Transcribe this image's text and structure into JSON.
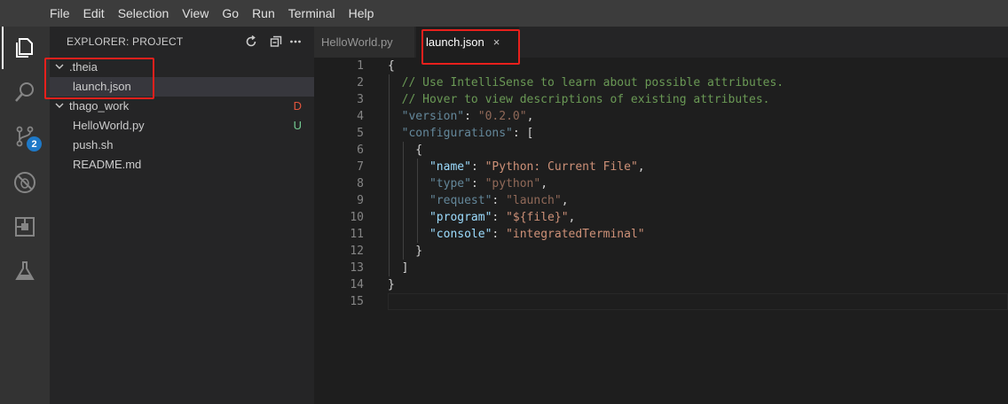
{
  "menu": [
    "File",
    "Edit",
    "Selection",
    "View",
    "Go",
    "Run",
    "Terminal",
    "Help"
  ],
  "activity_bar": {
    "items": [
      "explorer-icon",
      "search-icon",
      "source-control-icon",
      "debug-icon",
      "extensions-icon",
      "test-flask-icon"
    ],
    "source_control_badge": "2"
  },
  "explorer": {
    "title": "EXPLORER: PROJECT",
    "actions": [
      "refresh-icon",
      "collapse-all-icon",
      "more-icon"
    ],
    "tree": [
      {
        "label": ".theia",
        "type": "folder",
        "expanded": true
      },
      {
        "label": "launch.json",
        "type": "file",
        "selected": true
      },
      {
        "label": "thago_work",
        "type": "folder",
        "expanded": true,
        "decoration": "D"
      },
      {
        "label": "HelloWorld.py",
        "type": "file",
        "decoration": "U"
      },
      {
        "label": "push.sh",
        "type": "file"
      },
      {
        "label": "README.md",
        "type": "file"
      }
    ]
  },
  "tabs": [
    {
      "label": "HelloWorld.py",
      "active": false
    },
    {
      "label": "launch.json",
      "active": true,
      "close": "×"
    }
  ],
  "editor": {
    "line_numbers": [
      "1",
      "2",
      "3",
      "4",
      "5",
      "6",
      "7",
      "8",
      "9",
      "10",
      "11",
      "12",
      "13",
      "14",
      "15"
    ],
    "lines": [
      [
        {
          "t": "{",
          "c": "tok-punct"
        }
      ],
      [
        {
          "t": "  // Use IntelliSense to learn about possible attributes.",
          "c": "tok-comment"
        }
      ],
      [
        {
          "t": "  // Hover to view descriptions of existing attributes.",
          "c": "tok-comment"
        }
      ],
      [
        {
          "t": "  ",
          "c": "tok-punct"
        },
        {
          "t": "\"version\"",
          "c": "tok-key-dim"
        },
        {
          "t": ": ",
          "c": "tok-punct"
        },
        {
          "t": "\"0.2.0\"",
          "c": "tok-str-dim"
        },
        {
          "t": ",",
          "c": "tok-punct"
        }
      ],
      [
        {
          "t": "  ",
          "c": "tok-punct"
        },
        {
          "t": "\"configurations\"",
          "c": "tok-key-dim"
        },
        {
          "t": ": [",
          "c": "tok-punct"
        }
      ],
      [
        {
          "t": "    {",
          "c": "tok-punct"
        }
      ],
      [
        {
          "t": "      ",
          "c": "tok-punct"
        },
        {
          "t": "\"name\"",
          "c": "tok-key"
        },
        {
          "t": ": ",
          "c": "tok-punct"
        },
        {
          "t": "\"Python: Current File\"",
          "c": "tok-str"
        },
        {
          "t": ",",
          "c": "tok-punct"
        }
      ],
      [
        {
          "t": "      ",
          "c": "tok-punct"
        },
        {
          "t": "\"type\"",
          "c": "tok-key-dim"
        },
        {
          "t": ": ",
          "c": "tok-punct"
        },
        {
          "t": "\"python\"",
          "c": "tok-str-dim"
        },
        {
          "t": ",",
          "c": "tok-punct"
        }
      ],
      [
        {
          "t": "      ",
          "c": "tok-punct"
        },
        {
          "t": "\"request\"",
          "c": "tok-key-dim"
        },
        {
          "t": ": ",
          "c": "tok-punct"
        },
        {
          "t": "\"launch\"",
          "c": "tok-str-dim"
        },
        {
          "t": ",",
          "c": "tok-punct"
        }
      ],
      [
        {
          "t": "      ",
          "c": "tok-punct"
        },
        {
          "t": "\"program\"",
          "c": "tok-key"
        },
        {
          "t": ": ",
          "c": "tok-punct"
        },
        {
          "t": "\"${file}\"",
          "c": "tok-str"
        },
        {
          "t": ",",
          "c": "tok-punct"
        }
      ],
      [
        {
          "t": "      ",
          "c": "tok-punct"
        },
        {
          "t": "\"console\"",
          "c": "tok-key"
        },
        {
          "t": ": ",
          "c": "tok-punct"
        },
        {
          "t": "\"integratedTerminal\"",
          "c": "tok-str"
        }
      ],
      [
        {
          "t": "    }",
          "c": "tok-punct"
        }
      ],
      [
        {
          "t": "  ]",
          "c": "tok-punct"
        }
      ],
      [
        {
          "t": "}",
          "c": "tok-punct"
        }
      ],
      [
        {
          "t": "",
          "c": "tok-punct"
        }
      ]
    ]
  },
  "colors": {
    "annotation": "#e8201c",
    "badge": "#1e79c8",
    "deleted": "#e2553d",
    "untracked": "#73c991"
  }
}
